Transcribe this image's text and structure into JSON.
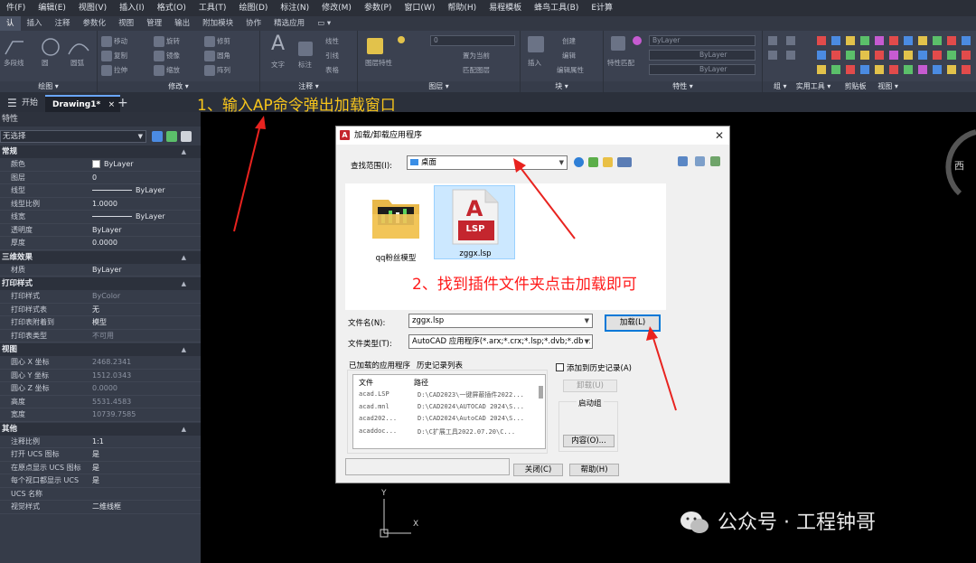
{
  "menubar": [
    "件(F)",
    "编辑(E)",
    "视图(V)",
    "插入(I)",
    "格式(O)",
    "工具(T)",
    "绘图(D)",
    "标注(N)",
    "修改(M)",
    "参数(P)",
    "窗口(W)",
    "帮助(H)",
    "易程模板",
    "蜂鸟工具(B)",
    "E计算"
  ],
  "ribbon_tabs": [
    "认",
    "插入",
    "注释",
    "参数化",
    "视图",
    "管理",
    "输出",
    "附加模块",
    "协作",
    "精选应用"
  ],
  "ribbon": {
    "panels": [
      "绘图",
      "修改",
      "注释",
      "图层",
      "块",
      "特性",
      "组",
      "实用工具",
      "剪贴板",
      "视图"
    ],
    "draw_items": [
      "多段线",
      "圆",
      "圆弧"
    ],
    "modify_items": [
      "移动",
      "旋转",
      "修剪",
      "复制",
      "镜像",
      "圆角",
      "拉伸",
      "缩放",
      "阵列"
    ],
    "annotate_items": [
      "文字",
      "标注",
      "线性",
      "引线",
      "表格"
    ],
    "layer_items": [
      "图层特性",
      "置为当前",
      "匹配图层"
    ],
    "block_items": [
      "插入",
      "创建",
      "编辑",
      "编辑属性"
    ],
    "props_items": [
      "特性匹配"
    ],
    "combo_value": "0",
    "bylayer": "ByLayer"
  },
  "doc_tabs": {
    "menu_icon": "menu-icon",
    "start": "开始",
    "drawing": "Drawing1*",
    "close": "×",
    "add": "+"
  },
  "palette": {
    "title": "特性",
    "selection": "无选择",
    "sections": [
      {
        "name": "常规",
        "rows": [
          {
            "k": "颜色",
            "v": "ByLayer"
          },
          {
            "k": "图层",
            "v": "0"
          },
          {
            "k": "线型",
            "v": "ByLayer"
          },
          {
            "k": "线型比例",
            "v": "1.0000"
          },
          {
            "k": "线宽",
            "v": "ByLayer"
          },
          {
            "k": "透明度",
            "v": "ByLayer"
          },
          {
            "k": "厚度",
            "v": "0.0000"
          }
        ]
      },
      {
        "name": "三维效果",
        "rows": [
          {
            "k": "材质",
            "v": "ByLayer"
          }
        ]
      },
      {
        "name": "打印样式",
        "rows": [
          {
            "k": "打印样式",
            "v": "ByColor"
          },
          {
            "k": "打印样式表",
            "v": "无"
          },
          {
            "k": "打印表附着到",
            "v": "模型"
          },
          {
            "k": "打印表类型",
            "v": "不可用"
          }
        ]
      },
      {
        "name": "视图",
        "rows": [
          {
            "k": "圆心 X 坐标",
            "v": "2468.2341"
          },
          {
            "k": "圆心 Y 坐标",
            "v": "1512.0343"
          },
          {
            "k": "圆心 Z 坐标",
            "v": "0.0000"
          },
          {
            "k": "高度",
            "v": "5531.4583"
          },
          {
            "k": "宽度",
            "v": "10739.7585"
          }
        ]
      },
      {
        "name": "其他",
        "rows": [
          {
            "k": "注释比例",
            "v": "1:1"
          },
          {
            "k": "打开 UCS 图标",
            "v": "是"
          },
          {
            "k": "在原点显示 UCS 图标",
            "v": "是"
          },
          {
            "k": "每个视口都显示 UCS",
            "v": "是"
          },
          {
            "k": "UCS 名称",
            "v": ""
          },
          {
            "k": "视觉样式",
            "v": "二维线框"
          }
        ]
      }
    ]
  },
  "annotations": {
    "step1": "1、输入AP命令弹出加载窗口",
    "step2": "2、找到插件文件夹点击加载即可"
  },
  "viewcube_label": "西",
  "ucs": {
    "y": "Y",
    "x": "X"
  },
  "dialog": {
    "title": "加载/卸载应用程序",
    "close": "✕",
    "lookin_label": "查找范围(I):",
    "lookin_value": "桌面",
    "files": [
      {
        "name": "qq粉丝模型",
        "type": "folder"
      },
      {
        "name": "zggx.lsp",
        "type": "lsp",
        "badge": "LSP"
      }
    ],
    "filename_label": "文件名(N):",
    "filename_value": "zggx.lsp",
    "filetype_label": "文件类型(T):",
    "filetype_value": "AutoCAD 应用程序(*.arx;*.crx;*.lsp;*.dvb;*.dbx;",
    "load_button": "加载(L)",
    "loaded_tab": "已加载的应用程序",
    "history_tab": "历史记录列表",
    "add_history": "添加到历史记录(A)",
    "list_headers": [
      "文件",
      "路径"
    ],
    "list_rows": [
      [
        "acad.LSP",
        "D:\\CAD2023\\一键屏蔽插件2022..."
      ],
      [
        "acad.mnl",
        "D:\\CAD2024\\AUTOCAD 2024\\S..."
      ],
      [
        "acad202...",
        "D:\\CAD2024\\AutoCAD 2024\\S..."
      ],
      [
        "acaddoc...",
        "D:\\C扩展工具2022.07.20\\C..."
      ]
    ],
    "unload_button": "卸载(U)",
    "startup_label": "启动组",
    "contents_button": "内容(O)...",
    "close_button": "关闭(C)",
    "help_button": "帮助(H)"
  },
  "watermark": "公众号 · 工程钟哥",
  "colors": {
    "annotation_yellow": "#f7c51b",
    "annotation_red": "#ff1a1a",
    "arrow_red": "#e8231f",
    "ribbon_bg": "#3b4150"
  }
}
